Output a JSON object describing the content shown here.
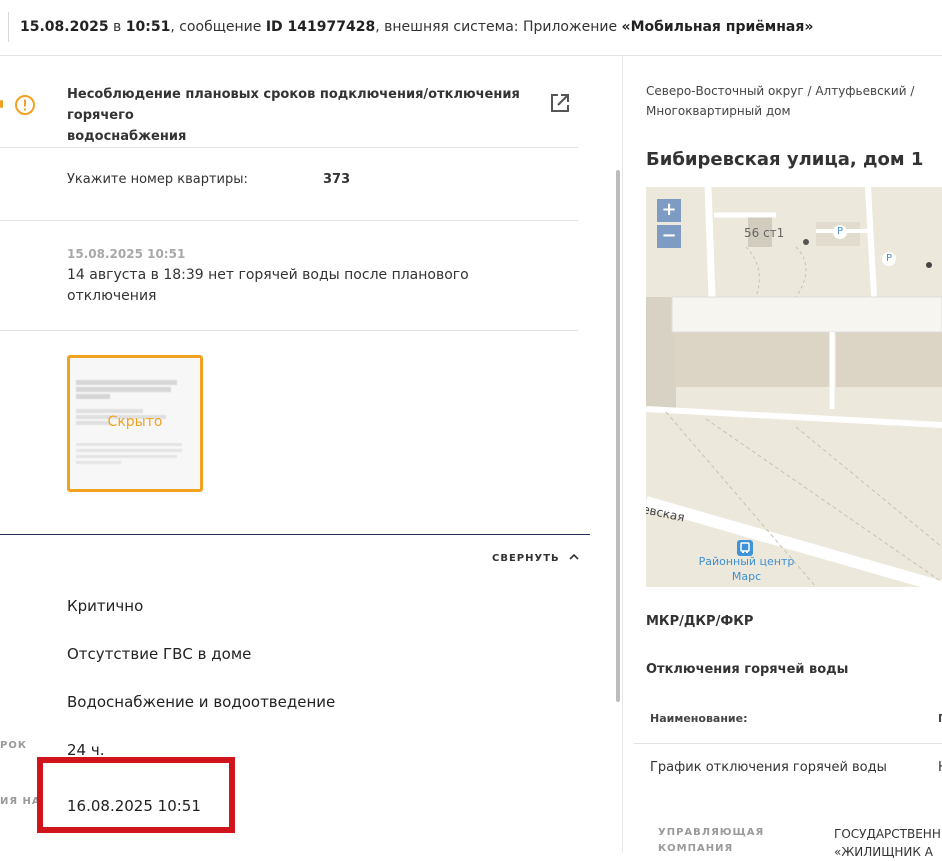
{
  "header": {
    "date": "15.08.2025",
    "in_word": "в",
    "time": "10:51",
    "message_label": "сообщение",
    "message_id": "ID 141977428",
    "system_label": "внешняя система: Приложение",
    "system_name": "«Мобильная приёмная»"
  },
  "problem": {
    "title_line1": "Несоблюдение плановых сроков подключения/отключения горячего",
    "title_line2": "водоснабжения"
  },
  "apartment": {
    "label": "Укажите номер квартиры:",
    "value": "373"
  },
  "comment": {
    "timestamp": "15.08.2025 10:51",
    "text_line1": "14 августа в 18:39 нет горячей воды после планового",
    "text_line2": "отключения"
  },
  "attachment": {
    "hidden_label": "Скрыто"
  },
  "collapse": {
    "label": "СВЕРНУТЬ"
  },
  "details": {
    "priority": "Критично",
    "category": "Отсутствие ГВС в доме",
    "service": "Водоснабжение и водоотведение",
    "deadline_label_fragment": "РОК",
    "deadline": "24 ч.",
    "due_label_fragment": "ИЯ НА",
    "due_date": "16.08.2025 10:51"
  },
  "location": {
    "breadcrumb_line1": "Северо-Восточный округ / Алтуфьевский /",
    "breadcrumb_line2": "Многоквартирный дом",
    "address": "Бибиревская улица, дом 1"
  },
  "map": {
    "zoom_in": "+",
    "zoom_out": "−",
    "building_label": "56 ст1",
    "parking1": "P",
    "parking2": "P",
    "street_label": "евская",
    "poi_line1": "Районный центр",
    "poi_line2": "Марс"
  },
  "programs": {
    "mkr_label": "МКР/ДКР/ФКР",
    "section_title": "Отключения горячей воды",
    "col_name": "Наименование:",
    "col2_fragment": "П",
    "row_name": "График отключения горячей воды",
    "row_col2_fragment": "Н"
  },
  "management": {
    "label_line1": "УПРАВЛЯЮЩАЯ",
    "label_line2": "КОМПАНИЯ",
    "value_line1": "ГОСУДАРСТВЕНН",
    "value_line2": "«ЖИЛИЩНИК А"
  },
  "colors": {
    "accent_orange": "#f0a220",
    "highlight_red": "#d0141c",
    "map_zoom": "#7e9bc4"
  }
}
